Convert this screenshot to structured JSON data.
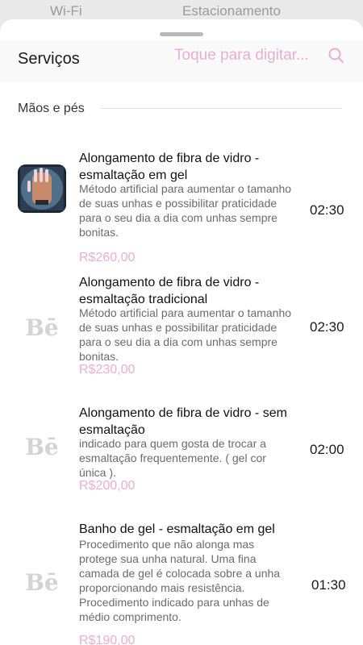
{
  "background": {
    "left_text": "Wi-Fi",
    "right_text": "Estacionamento"
  },
  "header": {
    "title": "Serviços",
    "search_placeholder": "Toque para digitar..."
  },
  "section": {
    "title": "Mãos e pés"
  },
  "services": [
    {
      "title": "Alongamento de fibra de vidro - esmaltação em gel",
      "description": "Método artificial para aumentar o tamanho de suas unhas e possibilitar praticidade para o seu dia a dia com unhas sempre bonitas.",
      "price": "R$260,00",
      "duration": "02:30",
      "thumb": "nail-photo"
    },
    {
      "title": "Alongamento de fibra de vidro - esmaltação tradicional",
      "description": "Método artificial para aumentar o tamanho de suas unhas e possibilitar praticidade para o seu dia a dia com unhas sempre bonitas.",
      "price": "R$230,00",
      "duration": "02:30",
      "thumb": "be-logo"
    },
    {
      "title": "Alongamento de fibra de vidro - sem esmaltação",
      "description": "indicado para quem gosta de trocar a esmaltação frequentemente. ( gel cor única ).",
      "price": "R$200,00",
      "duration": "02:00",
      "thumb": "be-logo"
    },
    {
      "title": "Banho de gel - esmaltação em gel",
      "description": "Procedimento que não alonga mas protege sua unha natural. Uma fina camada de gel é colocada sobre a unha proporcionando mais resistência. Procedimento indicado para unhas de médio comprimento.",
      "price": "R$190,00",
      "duration": "01:30",
      "thumb": "be-logo"
    }
  ],
  "logo_text": "Bē",
  "colors": {
    "accent_pink": "#eaaed2",
    "text": "#1a1a1a",
    "muted": "#6b6b6b"
  }
}
